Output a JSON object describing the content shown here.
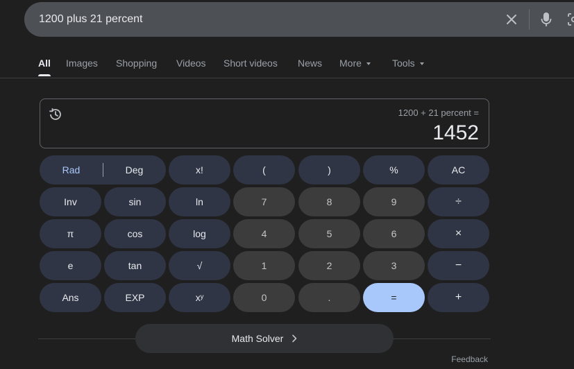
{
  "search": {
    "query": "1200 plus 21 percent"
  },
  "icons": {
    "clear": "close-icon",
    "voice": "microphone-icon",
    "lens": "camera-icon",
    "history": "history-icon",
    "solver_chevron": "chevron-right-icon"
  },
  "tabs": [
    {
      "label": "All",
      "active": true
    },
    {
      "label": "Images"
    },
    {
      "label": "Shopping"
    },
    {
      "label": "Videos"
    },
    {
      "label": "Short videos"
    },
    {
      "label": "News"
    },
    {
      "label": "More"
    },
    {
      "label": "Tools"
    }
  ],
  "calculator": {
    "expression": "1200 + 21 percent =",
    "result": "1452",
    "rad_label": "Rad",
    "deg_label": "Deg",
    "keys": {
      "fact": "x!",
      "lparen": "(",
      "rparen": ")",
      "percent": "%",
      "ac": "AC",
      "inv": "Inv",
      "sin": "sin",
      "ln": "ln",
      "d7": "7",
      "d8": "8",
      "d9": "9",
      "divide": "÷",
      "pi": "π",
      "cos": "cos",
      "log": "log",
      "d4": "4",
      "d5": "5",
      "d6": "6",
      "multiply": "×",
      "e": "e",
      "tan": "tan",
      "sqrt": "√",
      "d1": "1",
      "d2": "2",
      "d3": "3",
      "minus": "−",
      "ans": "Ans",
      "exp": "EXP",
      "pow": "xʸ",
      "d0": "0",
      "dot": ".",
      "equals": "=",
      "plus": "+"
    }
  },
  "solver": {
    "label": "Math Solver"
  },
  "feedback_label": "Feedback",
  "colors": {
    "background": "#1f1f1f",
    "function_key": "#303545",
    "number_key": "#3c3c3c",
    "equals_key": "#a8c7fa",
    "accent": "#a8c7fa"
  }
}
